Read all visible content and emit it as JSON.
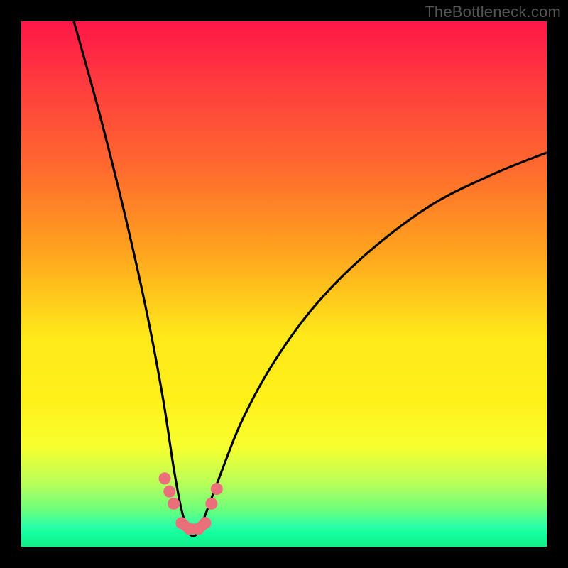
{
  "attribution": "TheBottleneck.com",
  "chart_data": {
    "type": "line",
    "title": "",
    "xlabel": "",
    "ylabel": "",
    "x_range": [
      0,
      100
    ],
    "y_range": [
      0,
      100
    ],
    "series": [
      {
        "name": "bottleneck-curve",
        "x": [
          10,
          15,
          20,
          24,
          27,
          29,
          30.5,
          32,
          33.5,
          35,
          38,
          42,
          48,
          56,
          66,
          78,
          90,
          100
        ],
        "y": [
          100,
          82,
          62,
          44,
          28,
          15,
          7,
          2.5,
          2.5,
          6,
          14,
          24,
          35,
          46,
          56,
          65,
          71,
          75
        ]
      }
    ],
    "markers": {
      "name": "highlight-beads",
      "color": "#eb6f7a",
      "points": [
        {
          "x": 27.3,
          "y": 13.0
        },
        {
          "x": 28.2,
          "y": 10.5
        },
        {
          "x": 29.0,
          "y": 8.2
        },
        {
          "x": 36.2,
          "y": 8.2
        },
        {
          "x": 37.2,
          "y": 11.0
        },
        {
          "x": 30.5,
          "y": 4.5
        },
        {
          "x": 32.0,
          "y": 3.4
        },
        {
          "x": 33.7,
          "y": 3.4
        },
        {
          "x": 35.0,
          "y": 4.5
        }
      ]
    },
    "gradient_stops": [
      {
        "pos": 0,
        "color": "#ff1648"
      },
      {
        "pos": 50,
        "color": "#ffcc1a"
      },
      {
        "pos": 80,
        "color": "#f5ff2a"
      },
      {
        "pos": 100,
        "color": "#10ee86"
      }
    ]
  }
}
